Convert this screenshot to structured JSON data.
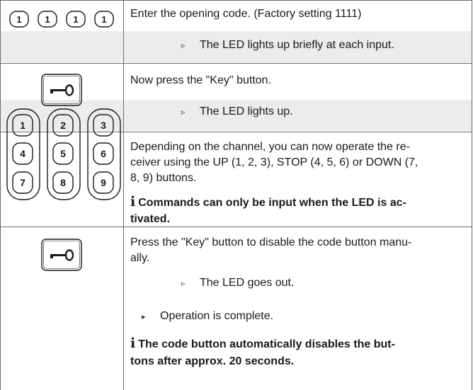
{
  "rows": [
    {
      "instruction": "Enter the opening code. (Factory setting 1111)",
      "result": "The LED lights up briefly at each input.",
      "icon": "code-keys-1111",
      "digits": [
        "1",
        "1",
        "1",
        "1"
      ]
    },
    {
      "instruction": "Now press the \"Key\" button.",
      "result": "The LED lights up.",
      "icon": "key-button-icon"
    },
    {
      "instruction_lines": [
        "Depending on the channel, you can now operate the re-",
        "ceiver using the UP (1, 2, 3), STOP (4, 5, 6) or DOWN (7,",
        "8, 9) buttons."
      ],
      "note_lines": [
        "Commands can only be input when the LED is ac-",
        "tivated."
      ],
      "icon": "keypad-icon",
      "keypad": [
        [
          "1",
          "4",
          "7"
        ],
        [
          "2",
          "5",
          "8"
        ],
        [
          "3",
          "6",
          "9"
        ]
      ]
    },
    {
      "instruction_lines": [
        "Press the \"Key\" button to disable the code button manu-",
        "ally."
      ],
      "result": "The LED goes out.",
      "outcome": "Operation is complete.",
      "note_lines": [
        "The code button automatically disables the but-",
        "tons after approx. 20 seconds."
      ],
      "icon": "key-button-icon"
    }
  ],
  "symbols": {
    "info": "i",
    "result_marker": "▹",
    "outcome_marker": "▸"
  }
}
